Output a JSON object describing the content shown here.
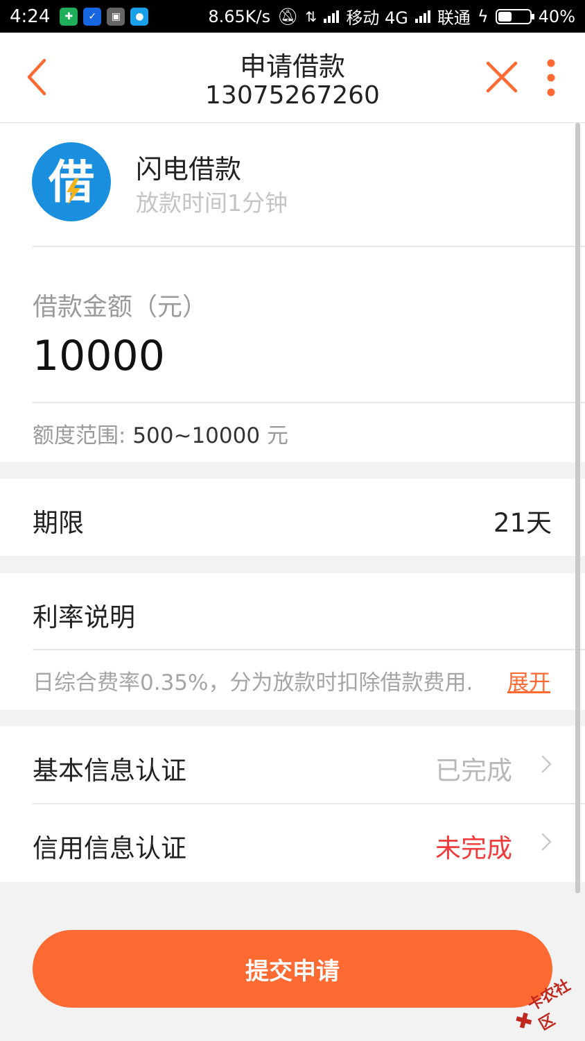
{
  "status_bar": {
    "time": "4:24",
    "speed": "8.65K/s",
    "carrier1": "移动 4G",
    "carrier2": "联通",
    "battery": "40%"
  },
  "header": {
    "title": "申请借款",
    "subtitle": "13075267260"
  },
  "lender": {
    "logo_char": "借",
    "name": "闪电借款",
    "desc": "放款时间1分钟"
  },
  "amount": {
    "label": "借款金额（元）",
    "value": "10000",
    "range_label": "额度范围:",
    "range_value": "500~10000",
    "range_unit": "元"
  },
  "term": {
    "label": "期限",
    "value": "21天"
  },
  "rate": {
    "label": "利率说明",
    "desc": "日综合费率0.35%，分为放款时扣除借款费用.",
    "expand": "展开"
  },
  "verification": [
    {
      "label": "基本信息认证",
      "status": "已完成",
      "color": "#b8b8b8"
    },
    {
      "label": "信用信息认证",
      "status": "未完成",
      "color": "#f03c3c"
    }
  ],
  "submit_label": "提交申请",
  "watermark": "卡农社区",
  "colors": {
    "accent": "#ff6a33",
    "logo_blue": "#1a8fe0",
    "pending_red": "#f03c3c"
  }
}
